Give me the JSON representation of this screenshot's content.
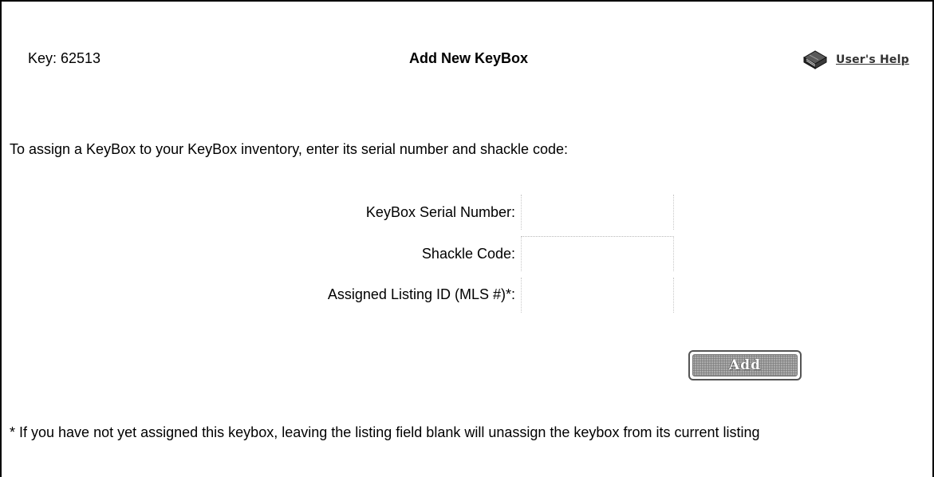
{
  "header": {
    "key_label": "Key: 62513",
    "title": "Add New KeyBox",
    "help_link": "User's Help",
    "help_icon": "book-icon"
  },
  "intro": "To assign a KeyBox to your KeyBox inventory, enter its serial number and shackle code:",
  "form": {
    "serial_label": "KeyBox Serial Number:",
    "serial_value": "",
    "shackle_label": "Shackle Code:",
    "shackle_value": "",
    "listing_label": "Assigned Listing ID (MLS #)*:",
    "listing_value": "",
    "add_label": "Add"
  },
  "footnote": "* If you have not yet assigned this keybox, leaving the listing field blank will unassign the keybox from its current listing"
}
